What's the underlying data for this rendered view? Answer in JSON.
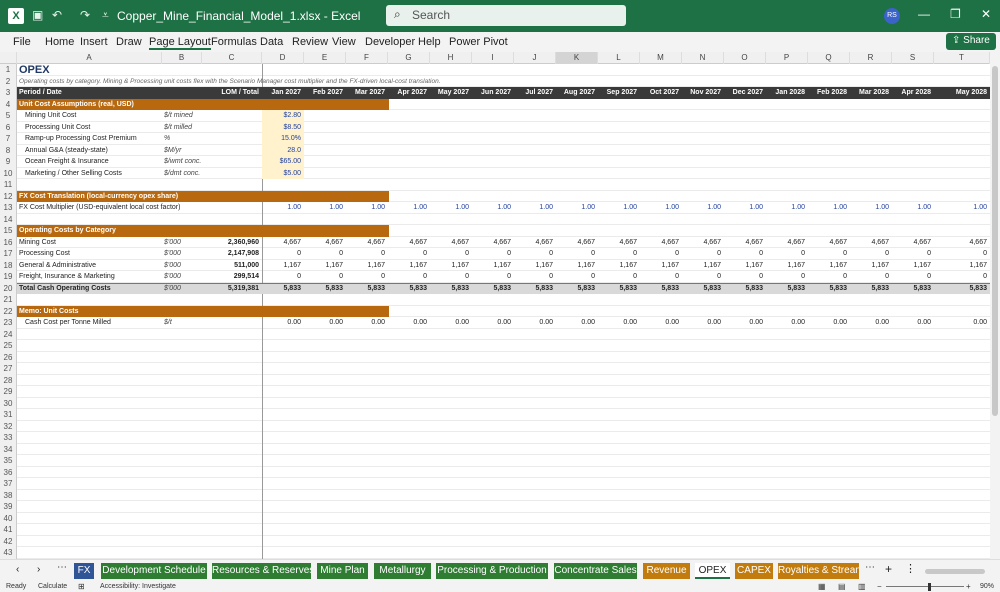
{
  "window": {
    "filename": "Copper_Mine_Financial_Model_1.xlsx",
    "app": "Excel",
    "search_placeholder": "Search",
    "avatar_initials": "RS"
  },
  "menu": [
    "File",
    "Home",
    "Insert",
    "Draw",
    "Page Layout",
    "Formulas",
    "Data",
    "Review",
    "View",
    "Developer",
    "Help",
    "Power Pivot"
  ],
  "share_label": "Share",
  "columns": [
    "A",
    "B",
    "C",
    "D",
    "E",
    "F",
    "G",
    "H",
    "I",
    "J",
    "K",
    "L",
    "M",
    "N",
    "O",
    "P",
    "Q",
    "R",
    "S",
    "T"
  ],
  "selected_column": "K",
  "sheet": {
    "title": "OPEX",
    "subtitle": "Operating costs by category. Mining & Processing unit costs flex with the Scenario Manager cost multiplier and the FX-driven local-cost translation.",
    "header_row": {
      "a": "Period / Date",
      "c": "LOM / Total",
      "periods": [
        "Jan 2027",
        "Feb 2027",
        "Mar 2027",
        "Apr 2027",
        "May 2027",
        "Jun 2027",
        "Jul 2027",
        "Aug 2027",
        "Sep 2027",
        "Oct 2027",
        "Nov 2027",
        "Dec 2027",
        "Jan 2028",
        "Feb 2028",
        "Mar 2028",
        "Apr 2028",
        "May 2028"
      ]
    },
    "sections": {
      "unit_cost": "Unit Cost Assumptions (real, USD)",
      "fx": "FX Cost Translation (local-currency opex share)",
      "opex": "Operating Costs by Category",
      "memo": "Memo: Unit Costs"
    },
    "assumptions": [
      {
        "label": "Mining Unit Cost",
        "unit": "$/t mined",
        "value": "$2.80"
      },
      {
        "label": "Processing Unit Cost",
        "unit": "$/t milled",
        "value": "$8.50"
      },
      {
        "label": "Ramp-up Processing Cost Premium",
        "unit": "%",
        "value": "15.0%"
      },
      {
        "label": "Annual G&A (steady-state)",
        "unit": "$M/yr",
        "value": "28.0"
      },
      {
        "label": "Ocean Freight & Insurance",
        "unit": "$/wmt conc.",
        "value": "$65.00"
      },
      {
        "label": "Marketing / Other Selling Costs",
        "unit": "$/dmt conc.",
        "value": "$5.00"
      }
    ],
    "fx_row": {
      "label": "FX Cost Multiplier (USD-equivalent local cost factor)",
      "value": "1.00"
    },
    "opex_rows": [
      {
        "label": "Mining Cost",
        "unit": "$'000",
        "total": "2,360,960",
        "value": "4,667"
      },
      {
        "label": "Processing Cost",
        "unit": "$'000",
        "total": "2,147,908",
        "value": "0"
      },
      {
        "label": "General & Administrative",
        "unit": "$'000",
        "total": "511,000",
        "value": "1,167"
      },
      {
        "label": "Freight, Insurance & Marketing",
        "unit": "$'000",
        "total": "299,514",
        "value": "0"
      }
    ],
    "total_row": {
      "label": "Total Cash Operating Costs",
      "unit": "$'000",
      "total": "5,319,381",
      "value": "5,833"
    },
    "memo_row": {
      "label": "Cash Cost per Tonne Milled",
      "unit": "$/t",
      "value": "0.00"
    }
  },
  "tabs": [
    {
      "label": "FX",
      "color": "#2f5597"
    },
    {
      "label": "Development Schedule",
      "color": "#2e7d32"
    },
    {
      "label": "Resources & Reserves",
      "color": "#2e7d32"
    },
    {
      "label": "Mine Plan",
      "color": "#2e7d32"
    },
    {
      "label": "Metallurgy",
      "color": "#2e7d32"
    },
    {
      "label": "Processing & Production",
      "color": "#2e7d32"
    },
    {
      "label": "Concentrate Sales",
      "color": "#2e7d32"
    },
    {
      "label": "Revenue",
      "color": "#c27c0e"
    },
    {
      "label": "OPEX",
      "color": "#ffffff"
    },
    {
      "label": "CAPEX",
      "color": "#c27c0e"
    },
    {
      "label": "Royalties & Strean",
      "color": "#c27c0e"
    }
  ],
  "status": {
    "ready": "Ready",
    "calculate": "Calculate",
    "accessibility": "Accessibility: Investigate",
    "zoom": "90%"
  },
  "colors": {
    "accent": "#1e7145",
    "section": "#b8690f",
    "input_fill": "#fff2cc",
    "header": "#3a3a3a"
  }
}
